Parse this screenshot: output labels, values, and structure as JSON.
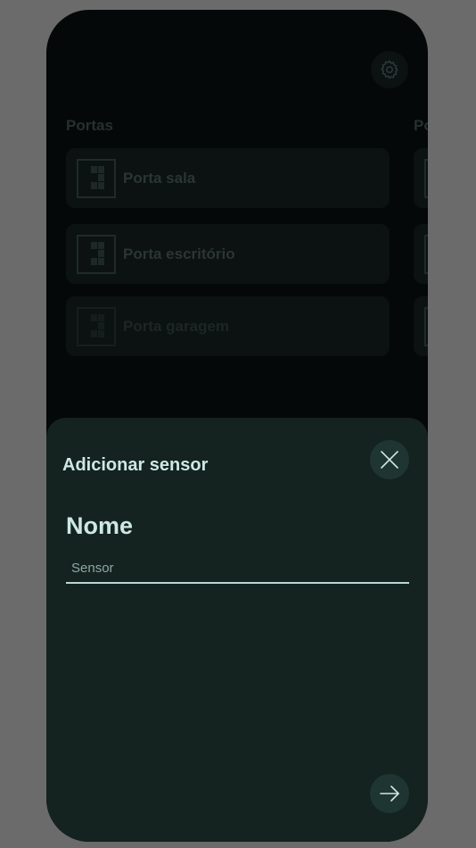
{
  "background": {
    "sections": [
      {
        "title": "Portas"
      },
      {
        "title": "Po"
      }
    ],
    "doors": [
      {
        "label": "Porta sala"
      },
      {
        "label": "Porta escritório"
      },
      {
        "label": "Porta garagem"
      }
    ]
  },
  "sheet": {
    "title": "Adicionar sensor",
    "field_label": "Nome",
    "name_placeholder": "Sensor"
  },
  "icons": {
    "settings": "gear-icon",
    "door": "door-icon",
    "close": "close-icon",
    "next": "arrow-right-icon"
  },
  "colors": {
    "sheet_bg": "#142220",
    "accent": "#cde8e2",
    "button_bg": "#1f3532"
  }
}
